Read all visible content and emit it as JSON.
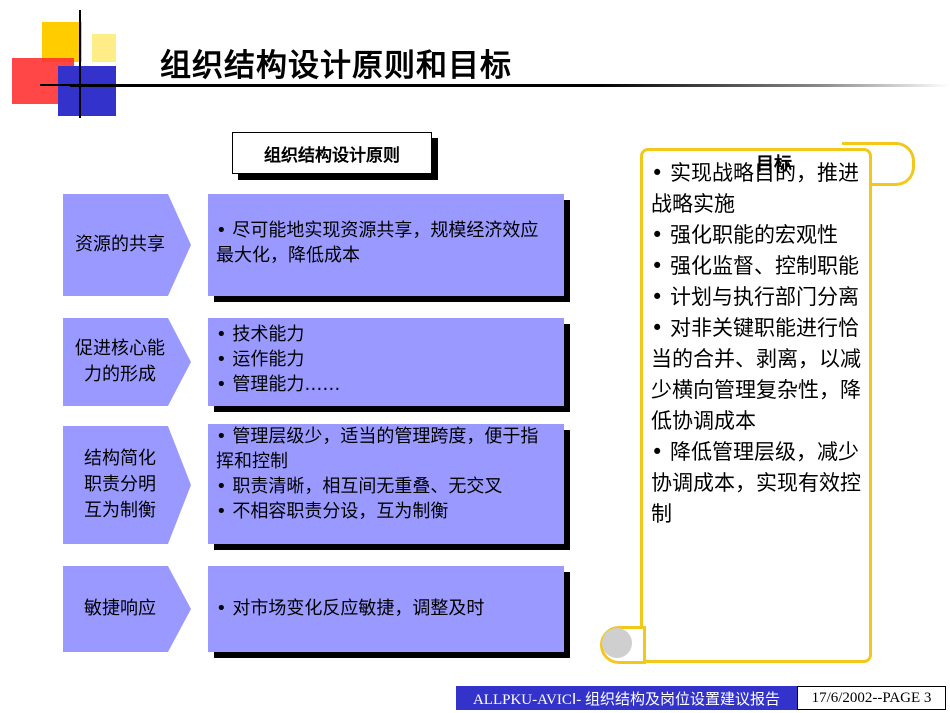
{
  "title": "组织结构设计原则和目标",
  "principles_header": "组织结构设计原则",
  "principles": [
    {
      "label_lines": [
        "资源的共享"
      ],
      "items": [
        "•  尽可能地实现资源共享，规模经济效应最大化，降低成本"
      ]
    },
    {
      "label_lines": [
        "促进核心能",
        "力的形成"
      ],
      "items": [
        "•  技术能力",
        "•  运作能力",
        "•  管理能力……"
      ]
    },
    {
      "label_lines": [
        "结构简化",
        "职责分明",
        "互为制衡"
      ],
      "items": [
        "•  管理层级少，适当的管理跨度，便于指挥和控制",
        "•  职责清晰，相互间无重叠、无交叉",
        "•  不相容职责分设，互为制衡"
      ]
    },
    {
      "label_lines": [
        "敏捷响应"
      ],
      "items": [
        "•  对市场变化反应敏捷，调整及时"
      ]
    }
  ],
  "goals_title": "目标",
  "goals": [
    "•    实现战略目的，推进战略实施",
    "•    强化职能的宏观性",
    "•    强化监督、控制职能",
    "•    计划与执行部门分离",
    "•  对非关键职能进行恰当的合并、剥离，以减少横向管理复杂性，降低协调成本",
    "•    降低管理层级，减少协调成本，实现有效控制"
  ],
  "footer": {
    "left": "ALLPKU-AVICⅠ- 组织结构及岗位设置建议报告",
    "right": "17/6/2002--PAGE 3"
  },
  "colors": {
    "box_fill": "#9999ff",
    "scroll_border": "#f2c81a",
    "footer_bar": "#3333cc"
  }
}
